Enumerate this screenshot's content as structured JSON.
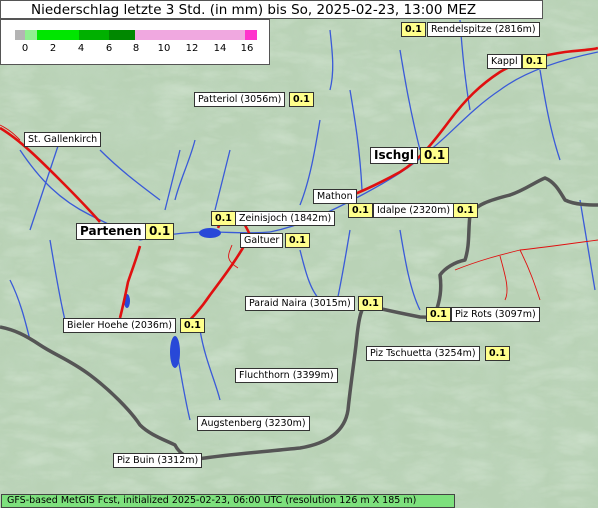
{
  "title": "Niederschlag letzte 3 Std. (in mm) bis So, 2025-02-23, 13:00 MEZ",
  "legend": {
    "ticks": [
      "0",
      "2",
      "4",
      "6",
      "8",
      "10",
      "12",
      "14",
      "16"
    ],
    "colors": {
      "zero": "#b4b4b4",
      "low": "#00e600",
      "mid": "#00b000",
      "dark": "#008800",
      "high": "#f0a8e0",
      "max": "#ff33cc"
    }
  },
  "places": [
    {
      "name": "Rendelspitze (2816m)",
      "value": "0.1"
    },
    {
      "name": "Kappl",
      "value": "0.1"
    },
    {
      "name": "Patteriol (3056m)",
      "value": "0.1"
    },
    {
      "name": "St. Gallenkirch",
      "value": ""
    },
    {
      "name": "Ischgl",
      "value": "0.1"
    },
    {
      "name": "Mathon",
      "value": ""
    },
    {
      "name": "Idalpe (2320m)",
      "value": "0.1"
    },
    {
      "name": "Zeinisjoch (1842m)",
      "value": "0.1"
    },
    {
      "name": "Partenen",
      "value": "0.1"
    },
    {
      "name": "Galtuer",
      "value": "0.1"
    },
    {
      "name": "Paraid Naira (3015m)",
      "value": "0.1"
    },
    {
      "name": "Piz Rots (3097m)",
      "value": "0.1"
    },
    {
      "name": "Bieler Hoehe (2036m)",
      "value": "0.1"
    },
    {
      "name": "Piz Tschuetta (3254m)",
      "value": "0.1"
    },
    {
      "name": "Fluchthorn (3399m)",
      "value": ""
    },
    {
      "name": "Augstenberg (3230m)",
      "value": ""
    },
    {
      "name": "Piz Buin (3312m)",
      "value": ""
    }
  ],
  "footer": "GFS-based MetGIS Fcst, initialized 2025-02-23, 06:00 UTC  (resolution 126 m X 185 m)"
}
